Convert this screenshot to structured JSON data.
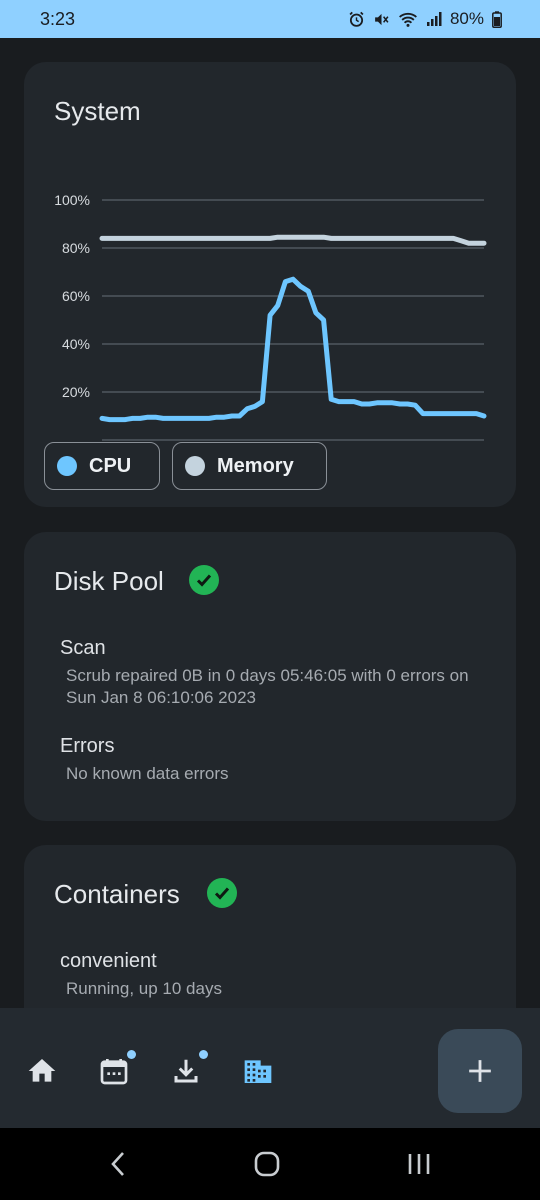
{
  "status_bar": {
    "time": "3:23",
    "battery": "80%",
    "icons": [
      "alarm-icon",
      "mute-icon",
      "wifi-icon",
      "signal-icon",
      "battery-charging-icon"
    ]
  },
  "system_card": {
    "title": "System",
    "legend": {
      "cpu_label": "CPU",
      "memory_label": "Memory"
    }
  },
  "chart_data": {
    "type": "line",
    "title": "",
    "y_ticks": [
      "100%",
      "80%",
      "60%",
      "40%",
      "20%"
    ],
    "ylim": [
      0,
      100
    ],
    "grid": true,
    "legend_placement": "bottom-left",
    "colors": {
      "cpu": "#6ec6ff",
      "memory": "#c4d3de"
    },
    "x": [
      0,
      1,
      2,
      3,
      4,
      5,
      6,
      7,
      8,
      9,
      10,
      11,
      12,
      13,
      14,
      15,
      16,
      17,
      18,
      19,
      20,
      21,
      22,
      23,
      24,
      25,
      26,
      27,
      28,
      29,
      30,
      31,
      32,
      33,
      34,
      35,
      36,
      37,
      38,
      39,
      40,
      41,
      42,
      43,
      44,
      45,
      46,
      47,
      48,
      49,
      50
    ],
    "series": [
      {
        "name": "CPU",
        "values": [
          9,
          8.5,
          8.5,
          8.5,
          9,
          9,
          9.5,
          9.5,
          9,
          9,
          9,
          9,
          9,
          9,
          9,
          9.5,
          9.5,
          10,
          10,
          13,
          14,
          16,
          52,
          56,
          66,
          67,
          64,
          62,
          53,
          50,
          17,
          16,
          16,
          16,
          15,
          15,
          15.5,
          15.5,
          15.5,
          15,
          15,
          14.5,
          11,
          11,
          11,
          11,
          11,
          11,
          11,
          11,
          10
        ]
      },
      {
        "name": "Memory",
        "values": [
          84,
          84,
          84,
          84,
          84,
          84,
          84,
          84,
          84,
          84,
          84,
          84,
          84,
          84,
          84,
          84,
          84,
          84,
          84,
          84,
          84,
          84,
          84,
          84.5,
          84.5,
          84.5,
          84.5,
          84.5,
          84.5,
          84.5,
          84,
          84,
          84,
          84,
          84,
          84,
          84,
          84,
          84,
          84,
          84,
          84,
          84,
          84,
          84,
          84,
          84,
          83,
          82,
          82,
          82
        ]
      }
    ]
  },
  "disk_pool_card": {
    "title": "Disk Pool",
    "scan_label": "Scan",
    "scan_text": "Scrub repaired 0B in 0 days 05:46:05 with 0 errors on Sun Jan 8 06:10:06 2023",
    "errors_label": "Errors",
    "errors_text": "No known data errors"
  },
  "containers_card": {
    "title": "Containers",
    "item_name": "convenient",
    "item_status": "Running, up 10 days"
  },
  "bottom_nav": {
    "items": [
      "home-icon",
      "calendar-icon",
      "download-icon",
      "apps-icon"
    ],
    "fab_icon": "plus-icon"
  },
  "system_nav": {
    "icons": [
      "back-icon",
      "home-circle-icon",
      "recents-icon"
    ]
  }
}
